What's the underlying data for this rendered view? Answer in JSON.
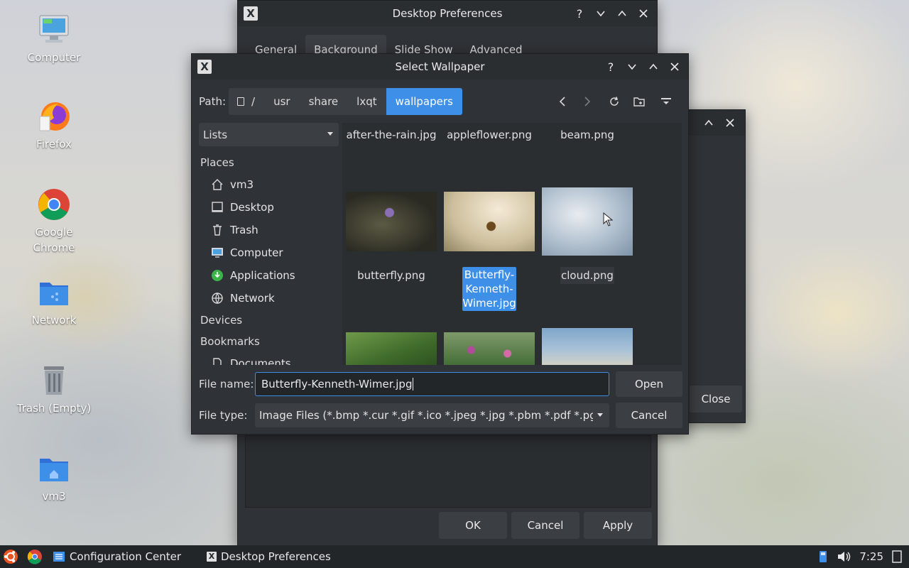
{
  "desktop": {
    "icons": [
      {
        "name": "computer",
        "label": "Computer"
      },
      {
        "name": "firefox",
        "label": "Firefox"
      },
      {
        "name": "chrome",
        "label_line1": "Google",
        "label_line2": "Chrome"
      },
      {
        "name": "network",
        "label": "Network"
      },
      {
        "name": "trash",
        "label": "Trash (Empty)"
      },
      {
        "name": "home",
        "label": "vm3"
      }
    ]
  },
  "desktop_prefs": {
    "title": "Desktop Preferences",
    "tabs": [
      "General",
      "Background",
      "Slide Show",
      "Advanced"
    ],
    "ok_label": "OK",
    "cancel_label": "Cancel",
    "apply_label": "Apply"
  },
  "config_window": {
    "close_label": "Close"
  },
  "dialog": {
    "title": "Select Wallpaper",
    "path_label": "Path:",
    "path": [
      "/",
      "usr",
      "share",
      "lxqt",
      "wallpapers"
    ],
    "view_mode": "Lists",
    "places_header": "Places",
    "places": [
      "vm3",
      "Desktop",
      "Trash",
      "Computer",
      "Applications",
      "Network"
    ],
    "devices_header": "Devices",
    "bookmarks_header": "Bookmarks",
    "bookmarks": [
      "Documents"
    ],
    "files_top": [
      "after-the-rain.jpg",
      "appleflower.png",
      "beam.png"
    ],
    "files_mid": [
      "butterfly.png",
      "Butterfly-Kenneth-Wimer.jpg",
      "cloud.png"
    ],
    "selected_file_lines": [
      "Butterfly-",
      "Kenneth-",
      "Wimer.jpg"
    ],
    "file_name_label": "File name:",
    "file_name_value": "Butterfly-Kenneth-Wimer.jpg",
    "file_type_label": "File type:",
    "file_type_value": "Image Files (*.bmp *.cur *.gif *.ico *.jpeg *.jpg *.pbm *.pdf *.pgm",
    "open_label": "Open",
    "cancel_label": "Cancel"
  },
  "taskbar": {
    "items": [
      "Configuration Center",
      "Desktop Preferences"
    ],
    "clock": "7:25"
  },
  "colors": {
    "accent": "#3d8fe8",
    "window_bg": "#2f3236",
    "taskbar_bg": "#232629"
  }
}
